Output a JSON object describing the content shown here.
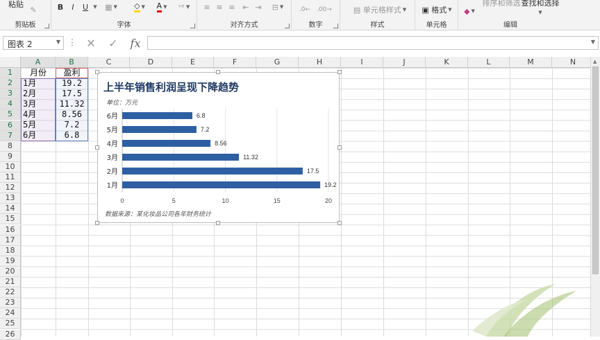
{
  "ribbon": {
    "clipboard": {
      "paste_label": "粘贴",
      "group_label": "剪贴板"
    },
    "font": {
      "group_label": "字体",
      "bold": "B",
      "italic": "I",
      "underline": "U"
    },
    "alignment": {
      "group_label": "对齐方式"
    },
    "number": {
      "group_label": "数字"
    },
    "styles": {
      "cell_styles_label": "单元格样式",
      "group_label": "样式"
    },
    "cells": {
      "format_label": "格式",
      "group_label": "单元格"
    },
    "editing": {
      "sort_filter_label": "排序和筛选",
      "find_select_label": "查找和选择",
      "group_label": "编辑"
    }
  },
  "formula_bar": {
    "name_box": "图表 2",
    "fx": "fx",
    "value": ""
  },
  "columns": [
    "A",
    "B",
    "C",
    "D",
    "E",
    "F",
    "G",
    "H",
    "I",
    "J",
    "K",
    "L",
    "M",
    "N"
  ],
  "rows": [
    "1",
    "2",
    "3",
    "4",
    "5",
    "6",
    "7",
    "8",
    "9",
    "10",
    "11",
    "12",
    "13",
    "14",
    "15",
    "16",
    "17",
    "18",
    "19",
    "20",
    "21",
    "22",
    "23",
    "24",
    "25",
    "26"
  ],
  "sheet": {
    "A": [
      "月份",
      "1月",
      "2月",
      "3月",
      "4月",
      "5月",
      "6月"
    ],
    "B": [
      "盈利",
      "19.2",
      "17.5",
      "11.32",
      "8.56",
      "7.2",
      "6.8"
    ]
  },
  "chart_data": {
    "type": "bar",
    "orientation": "horizontal",
    "title": "上半年销售利润呈现下降趋势",
    "subtitle": "单位：万元",
    "source": "数据来源：某化妆品公司各年财务统计",
    "categories": [
      "1月",
      "2月",
      "3月",
      "4月",
      "5月",
      "6月"
    ],
    "values": [
      19.2,
      17.5,
      11.32,
      8.56,
      7.2,
      6.8
    ],
    "value_labels": [
      "19.2",
      "17.5",
      "11.32",
      "8.56",
      "7.2",
      "6.8"
    ],
    "xlim": [
      0,
      20
    ],
    "xticks": [
      "0",
      "5",
      "10",
      "15",
      "20"
    ],
    "bar_color": "#2e5fa3",
    "grid": true,
    "legend": "none"
  },
  "colors": {
    "accent": "#217346",
    "title": "#1f3864"
  }
}
